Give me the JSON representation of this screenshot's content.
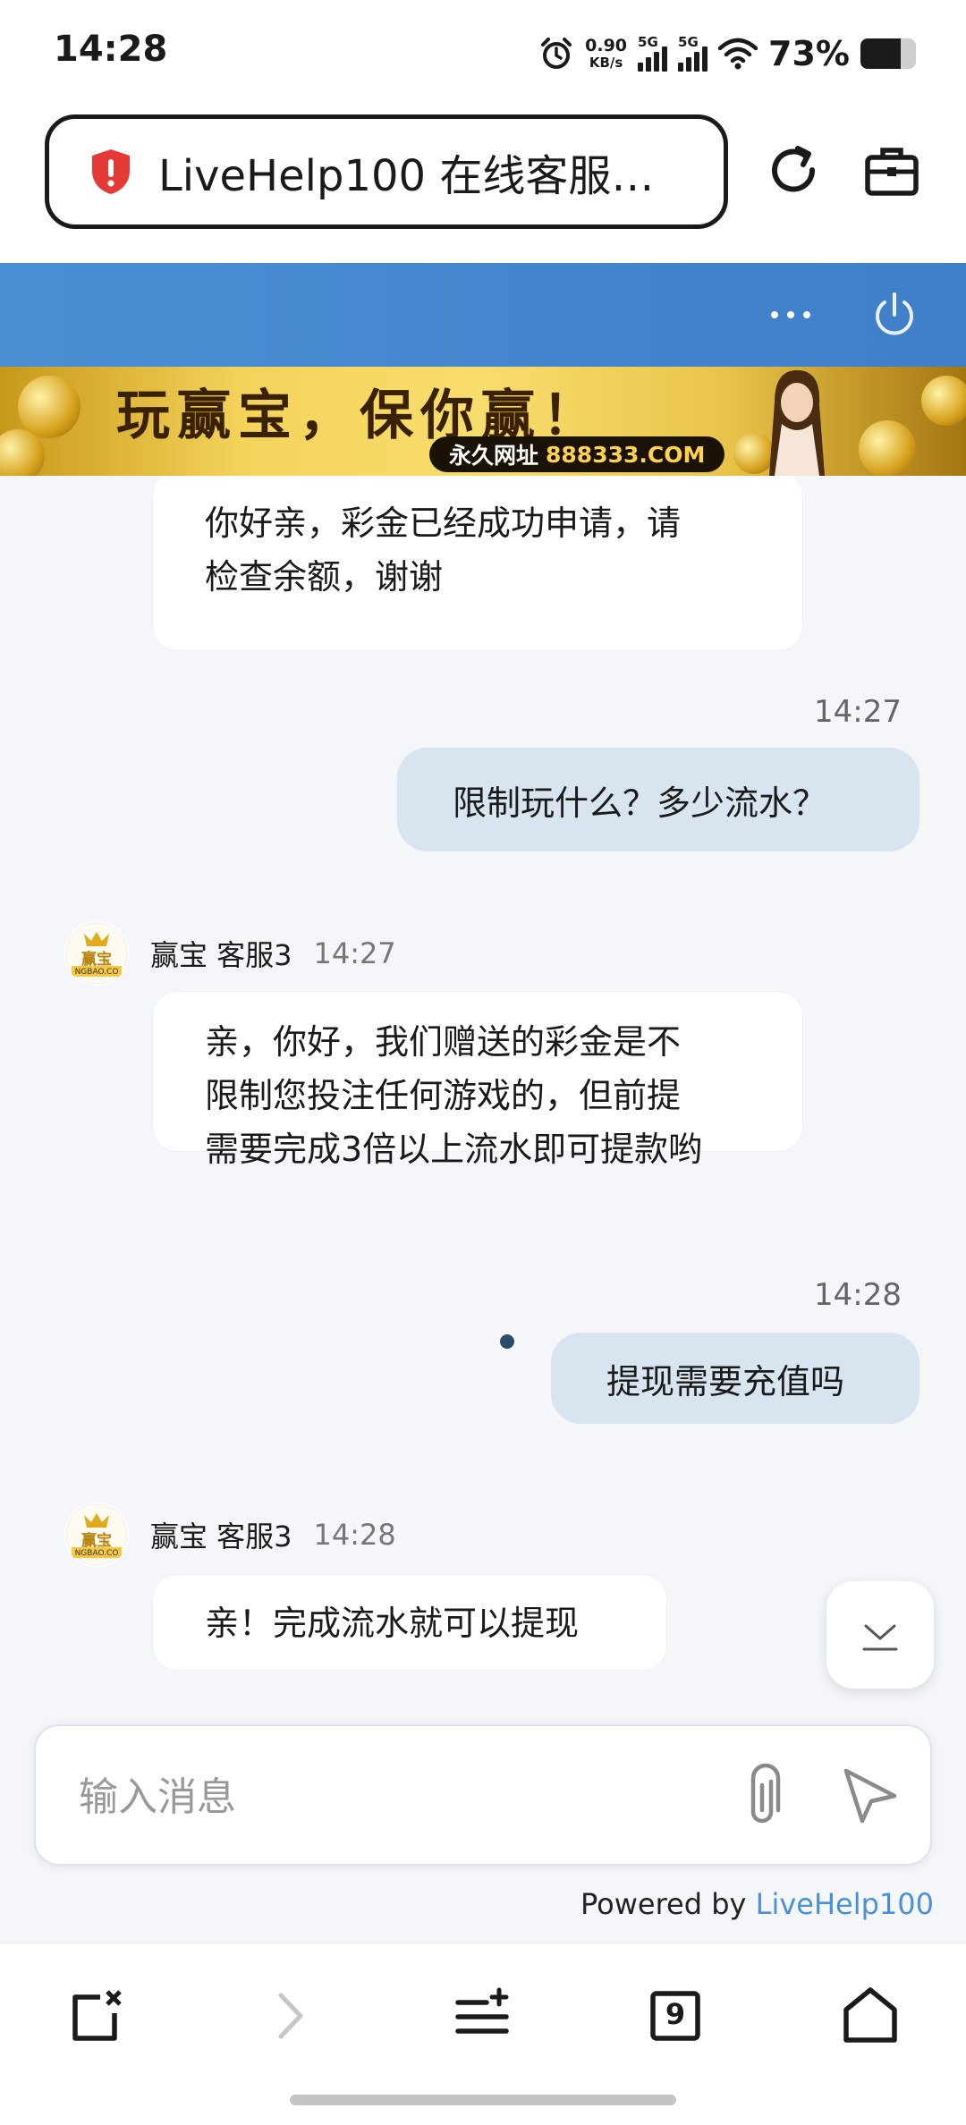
{
  "status_bar": {
    "time": "14:28",
    "net_speed_value": "0.90",
    "net_speed_unit": "KB/s",
    "sim1_label": "5G",
    "sim2_label": "5G",
    "battery_percent_text": "73%",
    "battery_level": 0.73
  },
  "browser": {
    "url_title": "LiveHelp100 在线客服…",
    "icons": {
      "security": "shield-alert-icon",
      "reload": "reload-icon",
      "toolbox": "toolbox-icon"
    }
  },
  "chat_header": {
    "icons": {
      "more": "more-icon",
      "power": "power-icon"
    }
  },
  "banner": {
    "slogan": "玩赢宝，保你赢！",
    "permanent_label": "永久网址",
    "domain": "888333.COM"
  },
  "messages": [
    {
      "direction": "in",
      "text_line1": "你好亲，彩金已经成功申请，请",
      "text_line2": "检查余额，谢谢"
    },
    {
      "direction": "out",
      "time": "14:27",
      "text": "限制玩什么？多少流水？"
    },
    {
      "direction": "in",
      "agent_name": "赢宝 客服3",
      "time": "14:27",
      "text_line1": "亲，你好，我们赠送的彩金是不",
      "text_line2": "限制您投注任何游戏的，但前提",
      "text_line3": "需要完成3倍以上流水即可提款哟"
    },
    {
      "direction": "out",
      "time": "14:28",
      "text": "提现需要充值吗"
    },
    {
      "direction": "in",
      "agent_name": "赢宝 客服3",
      "time": "14:28",
      "text": "亲！完成流水就可以提现"
    }
  ],
  "avatar_text": "赢宝",
  "avatar_subtext": "NGBAO.CO",
  "composer": {
    "placeholder": "输入消息",
    "icons": {
      "attach": "paperclip-icon",
      "send": "send-icon"
    }
  },
  "powered_by": {
    "prefix": "Powered by ",
    "brand": "LiveHelp100"
  },
  "bottom_nav": {
    "tab_count": "9",
    "icons": [
      "close-tab-icon",
      "forward-icon",
      "menu-icon",
      "tabs-icon",
      "home-icon"
    ]
  },
  "colors": {
    "header_blue": "#4a8fd4",
    "outgoing_bubble": "#d8e4f0",
    "brand_link": "#4a90d9",
    "shield_red": "#e53935"
  }
}
